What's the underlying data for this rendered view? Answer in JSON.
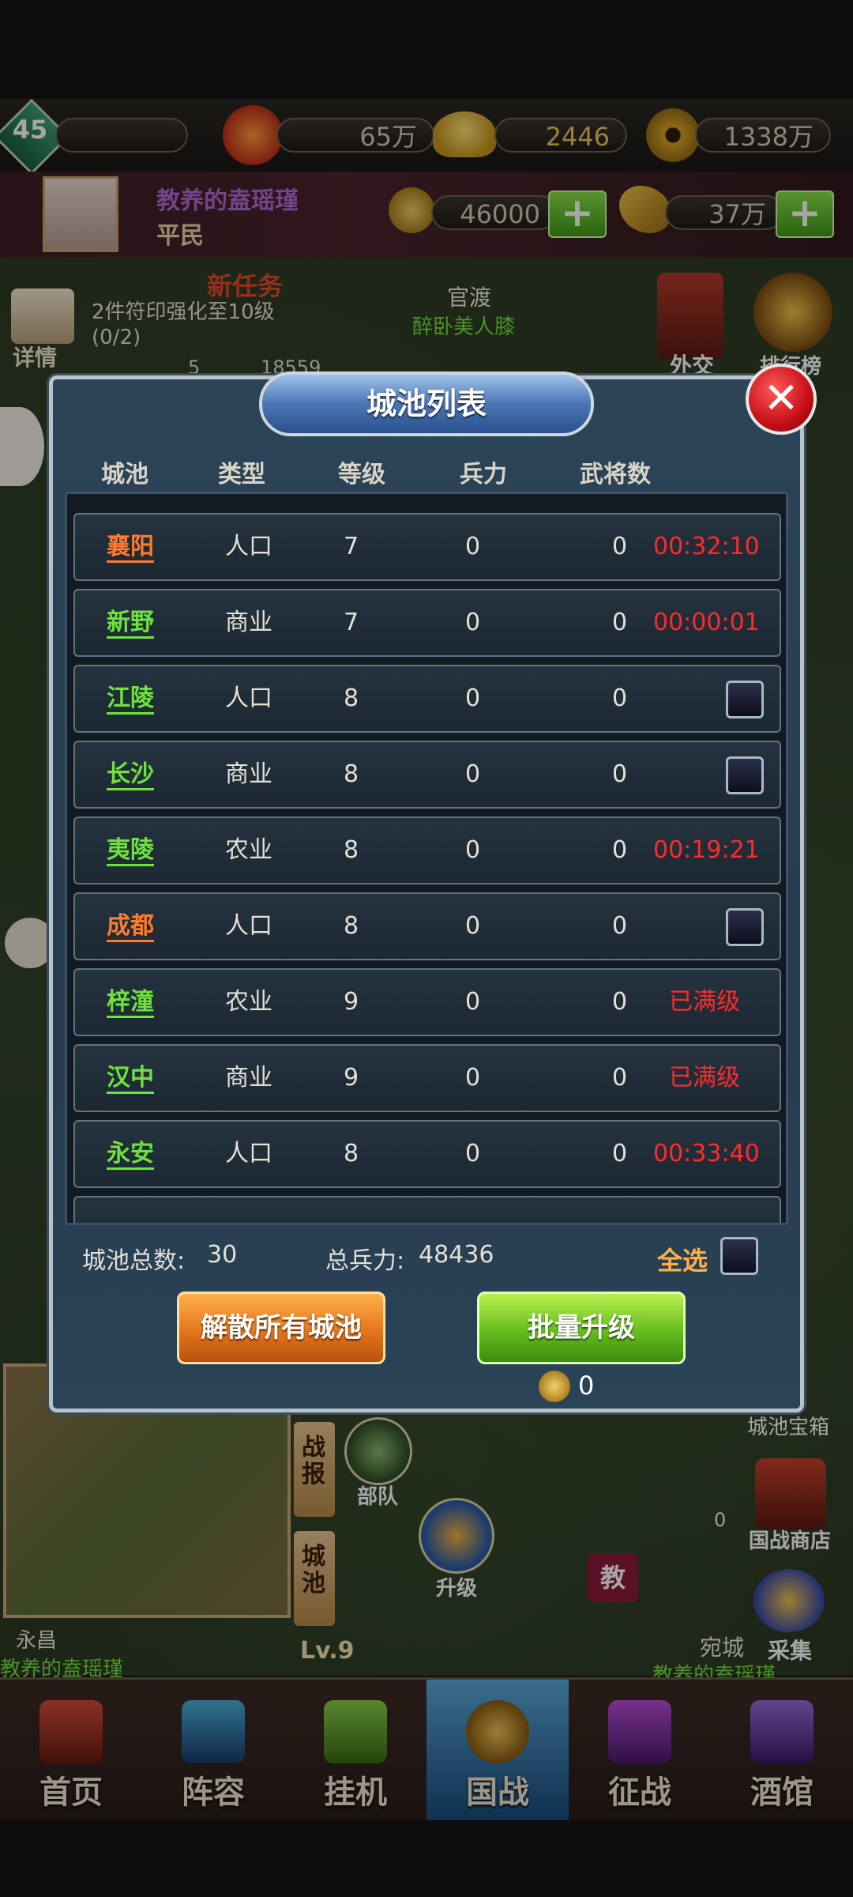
{
  "topbar": {
    "level": "45",
    "power": "65万",
    "ingots": "2446",
    "coins": "1338万"
  },
  "profile": {
    "name": "教养的盍瑶瑾",
    "rank": "平民",
    "silver": "46000",
    "grain": "37万"
  },
  "map": {
    "task_badge": "新任务",
    "task_text": "2件符印强化至10级(0/2)",
    "task_detail": "详情",
    "place_guandu": "官渡",
    "place_guandu_owner": "醉卧美人膝",
    "diplomacy": "外交",
    "ranking": "排行榜",
    "stat_a": "5",
    "stat_b": "18559",
    "troops": "部队",
    "upgrade": "升级",
    "battle_report": "战报",
    "city": "城池",
    "level_tag": "Lv.9",
    "yongchang": "永昌",
    "owner_left": "教养的盍瑶瑾",
    "wancheng": "宛城",
    "owner_right": "教养的盍瑶瑾",
    "collect": "采集",
    "city_box": "城池宝箱",
    "nation_shop": "国战商店",
    "teach": "教",
    "zero_counter": "0"
  },
  "dialog": {
    "title": "城池列表",
    "headers": [
      "城池",
      "类型",
      "等级",
      "兵力",
      "武将数"
    ],
    "rows": [
      {
        "name": "襄阳",
        "name_color": "#ff7a2a",
        "type": "人口",
        "level": "7",
        "troops": "0",
        "generals": "0",
        "status": "00:32:10",
        "status_kind": "timer"
      },
      {
        "name": "新野",
        "name_color": "#6fe23d",
        "type": "商业",
        "level": "7",
        "troops": "0",
        "generals": "0",
        "status": "00:00:01",
        "status_kind": "timer"
      },
      {
        "name": "江陵",
        "name_color": "#6fe23d",
        "type": "人口",
        "level": "8",
        "troops": "0",
        "generals": "0",
        "status": "",
        "status_kind": "checkbox"
      },
      {
        "name": "长沙",
        "name_color": "#6fe23d",
        "type": "商业",
        "level": "8",
        "troops": "0",
        "generals": "0",
        "status": "",
        "status_kind": "checkbox"
      },
      {
        "name": "夷陵",
        "name_color": "#6fe23d",
        "type": "农业",
        "level": "8",
        "troops": "0",
        "generals": "0",
        "status": "00:19:21",
        "status_kind": "timer"
      },
      {
        "name": "成都",
        "name_color": "#ff7a2a",
        "type": "人口",
        "level": "8",
        "troops": "0",
        "generals": "0",
        "status": "",
        "status_kind": "checkbox"
      },
      {
        "name": "梓潼",
        "name_color": "#6fe23d",
        "type": "农业",
        "level": "9",
        "troops": "0",
        "generals": "0",
        "status": "已满级",
        "status_kind": "max"
      },
      {
        "name": "汉中",
        "name_color": "#6fe23d",
        "type": "商业",
        "level": "9",
        "troops": "0",
        "generals": "0",
        "status": "已满级",
        "status_kind": "max"
      },
      {
        "name": "永安",
        "name_color": "#6fe23d",
        "type": "人口",
        "level": "8",
        "troops": "0",
        "generals": "0",
        "status": "00:33:40",
        "status_kind": "timer"
      }
    ],
    "total_cities_label": "城池总数:",
    "total_cities": "30",
    "total_troops_label": "总兵力:",
    "total_troops": "48436",
    "select_all": "全选",
    "disband_button": "解散所有城池",
    "batch_upgrade_button": "批量升级",
    "cost": "0"
  },
  "nav": {
    "items": [
      "首页",
      "阵容",
      "挂机",
      "国战",
      "征战",
      "酒馆"
    ],
    "active": "国战"
  },
  "colors": {
    "timer": "#ff2a2a",
    "orange_name": "#ff7a2a",
    "green_name": "#6fe23d",
    "select_all": "#ffb040"
  }
}
